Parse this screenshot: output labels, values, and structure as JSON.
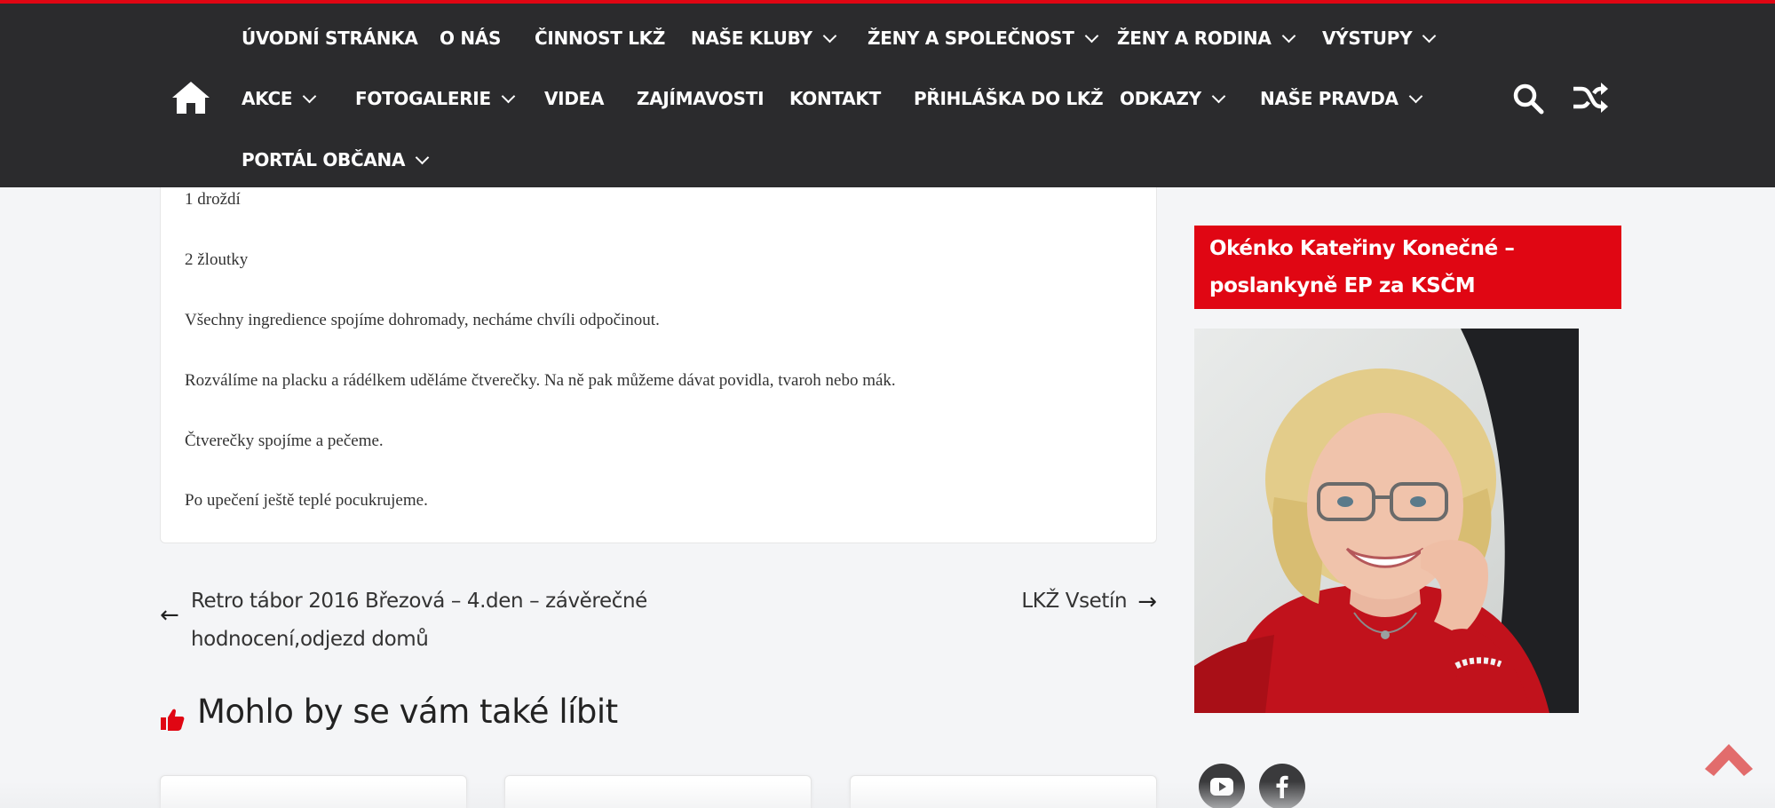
{
  "colors": {
    "accent": "#e00613",
    "nav_background": "#2b2b2d",
    "page_background": "#f4f5f7",
    "text": "#333333"
  },
  "nav": {
    "row1": [
      {
        "label": "ÚVODNÍ STRÁNKA",
        "dropdown": false
      },
      {
        "label": "O NÁS",
        "dropdown": false
      },
      {
        "label": "ČINNOST LKŽ",
        "dropdown": false
      },
      {
        "label": "NAŠE KLUBY",
        "dropdown": true
      },
      {
        "label": "ŽENY A SPOLEČNOST",
        "dropdown": true
      },
      {
        "label": "ŽENY A RODINA",
        "dropdown": true
      },
      {
        "label": "VÝSTUPY",
        "dropdown": true
      }
    ],
    "row2": [
      {
        "label": "AKCE",
        "dropdown": true
      },
      {
        "label": "FOTOGALERIE",
        "dropdown": true
      },
      {
        "label": "VIDEA",
        "dropdown": false
      },
      {
        "label": "ZAJÍMAVOSTI",
        "dropdown": false
      },
      {
        "label": "KONTAKT",
        "dropdown": false
      },
      {
        "label": "PŘIHLÁŠKA DO LKŽ",
        "dropdown": false
      },
      {
        "label": "ODKAZY",
        "dropdown": true
      },
      {
        "label": "NAŠE PRAVDA",
        "dropdown": true
      }
    ],
    "row3": [
      {
        "label": "PORTÁL OBČANA",
        "dropdown": true
      }
    ],
    "icons": {
      "home": "home-icon",
      "search": "search-icon",
      "random": "shuffle-icon"
    }
  },
  "article": {
    "lines": [
      "1 droždí",
      "2 žloutky",
      "Všechny ingredience spojíme dohromady, necháme chvíli odpočinout.",
      "Rozválíme na placku a rádélkem uděláme čtverečky. Na ně pak můžeme dávat povidla, tvaroh nebo mák.",
      "Čtverečky spojíme a pečeme.",
      "Po upečení ještě teplé pocukrujeme."
    ]
  },
  "post_nav": {
    "prev_arrow": "←",
    "prev_title": "Retro tábor 2016 Březová – 4.den – závěrečné hodnocení,odjezd domů",
    "next_title": "LKŽ Vsetín",
    "next_arrow": "→"
  },
  "related": {
    "title": "Mohlo by se vám také líbit",
    "icon": "thumbs-up-icon"
  },
  "sidebar": {
    "widget_title": "Okénko Kateřiny Konečné – poslankyně EP za KSČM",
    "portrait_icon": "portrait-photo",
    "social": [
      "youtube-icon",
      "facebook-icon"
    ]
  },
  "scroll_top_icon": "chevron-up-icon"
}
